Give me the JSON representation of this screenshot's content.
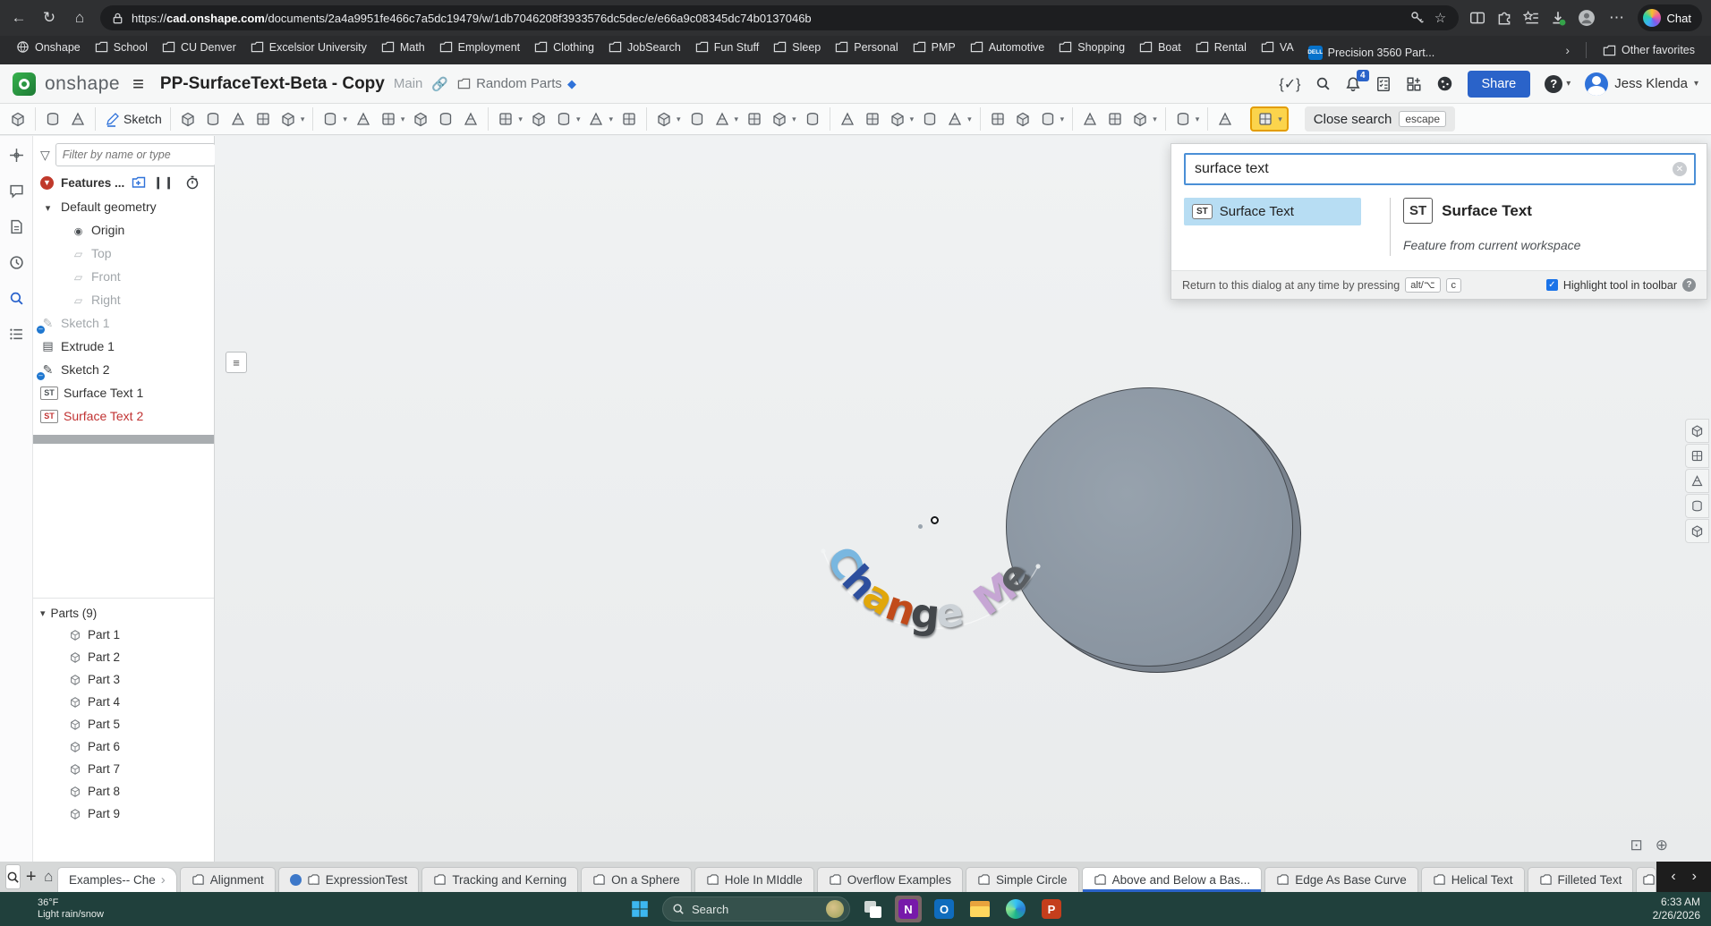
{
  "browser": {
    "url_prefix": "https://",
    "url_host": "cad.onshape.com",
    "url_path": "/documents/2a4a9951fe466c7a5dc19479/w/1db7046208f3933576dc5dec/e/e66a9c08345dc74b0137046b",
    "chat_label": "Chat",
    "bookmarks": [
      {
        "label": "Onshape",
        "icon": "site"
      },
      {
        "label": "School",
        "icon": "folder"
      },
      {
        "label": "CU Denver",
        "icon": "folder"
      },
      {
        "label": "Excelsior University",
        "icon": "folder"
      },
      {
        "label": "Math",
        "icon": "folder"
      },
      {
        "label": "Employment",
        "icon": "folder"
      },
      {
        "label": "Clothing",
        "icon": "folder"
      },
      {
        "label": "JobSearch",
        "icon": "folder"
      },
      {
        "label": "Fun Stuff",
        "icon": "folder"
      },
      {
        "label": "Sleep",
        "icon": "folder"
      },
      {
        "label": "Personal",
        "icon": "folder"
      },
      {
        "label": "PMP",
        "icon": "folder"
      },
      {
        "label": "Automotive",
        "icon": "folder"
      },
      {
        "label": "Shopping",
        "icon": "folder"
      },
      {
        "label": "Boat",
        "icon": "folder"
      },
      {
        "label": "Rental",
        "icon": "folder"
      },
      {
        "label": "VA",
        "icon": "folder"
      },
      {
        "label": "Precision 3560 Part...",
        "icon": "dell"
      }
    ],
    "dell_text": "DELL",
    "overflow_chevron": "›",
    "other_favorites": "Other favorites"
  },
  "header": {
    "brand": "onshape",
    "title": "PP-SurfaceText-Beta - Copy",
    "workspace": "Main",
    "location": "Random Parts",
    "notification_count": "4",
    "fs_icon": "{✓}",
    "share_label": "Share",
    "help_glyph": "?",
    "user_name": "Jess Klenda"
  },
  "toolbar": {
    "items": [
      {
        "n": "feature-list-icon"
      },
      {
        "n": "undo-icon",
        "s": true
      },
      {
        "n": "redo-icon"
      },
      {
        "n": "sketch-button",
        "s": true,
        "label": "Sketch"
      },
      {
        "n": "extrude-icon",
        "s": true
      },
      {
        "n": "revolve-icon"
      },
      {
        "n": "sweep-icon"
      },
      {
        "n": "loft-icon"
      },
      {
        "n": "thicken-icon",
        "c": true
      },
      {
        "n": "fillet-icon",
        "s": true,
        "c": true
      },
      {
        "n": "chamfer-icon"
      },
      {
        "n": "draft-icon",
        "c": true
      },
      {
        "n": "rib-icon"
      },
      {
        "n": "shell-icon"
      },
      {
        "n": "hole-icon"
      },
      {
        "n": "linear-pattern-icon",
        "s": true,
        "c": true
      },
      {
        "n": "circular-pattern-icon"
      },
      {
        "n": "mirror-icon",
        "c": true
      },
      {
        "n": "boolean-icon",
        "c": true
      },
      {
        "n": "split-icon"
      },
      {
        "n": "offset-surface-icon",
        "s": true,
        "c": true
      },
      {
        "n": "fill-surface-icon"
      },
      {
        "n": "ruled-surface-icon",
        "c": true
      },
      {
        "n": "move-face-icon"
      },
      {
        "n": "delete-face-icon",
        "c": true
      },
      {
        "n": "replace-face-icon"
      },
      {
        "n": "helix-icon",
        "s": true
      },
      {
        "n": "fit-spline-icon"
      },
      {
        "n": "projected-curve-icon",
        "c": true
      },
      {
        "n": "bridging-curve-icon"
      },
      {
        "n": "composite-curve-icon",
        "c": true
      },
      {
        "n": "variable-icon",
        "s": true
      },
      {
        "n": "featurescript-icon"
      },
      {
        "n": "derived-icon",
        "c": true
      },
      {
        "n": "measure-icon",
        "s": true
      },
      {
        "n": "mass-properties-icon"
      },
      {
        "n": "section-view-icon",
        "c": true
      },
      {
        "n": "named-views-icon",
        "s": true,
        "c": true
      },
      {
        "n": "select-region-icon",
        "s": true
      },
      {
        "n": "custom-feature-button",
        "hl": true,
        "c": true
      }
    ],
    "close_search_label": "Close search",
    "escape_key": "escape"
  },
  "search_panel": {
    "query": "surface text",
    "result_badge": "ST",
    "result_label": "Surface Text",
    "detail_badge": "ST",
    "detail_title": "Surface Text",
    "detail_subtitle": "Feature from current workspace",
    "footer_text": "Return to this dialog at any time by pressing",
    "key1": "alt/⌥",
    "key2": "c",
    "checkbox_glyph": "✓",
    "checkbox_label": "Highlight tool in toolbar"
  },
  "feature_panel": {
    "filter_placeholder": "Filter by name or type",
    "features_label": "Features ...",
    "pause_glyph": "❙❙",
    "error_glyph": "▼",
    "tree": [
      {
        "label": "Default geometry",
        "icon": "caret"
      },
      {
        "label": "Origin",
        "icon": "origin",
        "indent": 2
      },
      {
        "label": "Top",
        "icon": "plane",
        "indent": 2,
        "muted": true
      },
      {
        "label": "Front",
        "icon": "plane",
        "indent": 2,
        "muted": true
      },
      {
        "label": "Right",
        "icon": "plane",
        "indent": 2,
        "muted": true
      },
      {
        "label": "Sketch 1",
        "icon": "sketch",
        "muted": true
      },
      {
        "label": "Extrude 1",
        "icon": "extrude"
      },
      {
        "label": "Sketch 2",
        "icon": "sketch"
      },
      {
        "label": "Surface Text 1",
        "icon": "st"
      },
      {
        "label": "Surface Text 2",
        "icon": "st",
        "error": true
      }
    ],
    "parts_label": "Parts (9)",
    "parts": [
      "Part 1",
      "Part 2",
      "Part 3",
      "Part 4",
      "Part 5",
      "Part 6",
      "Part 7",
      "Part 8",
      "Part 9"
    ]
  },
  "viewport": {
    "model_text": "Change Me",
    "letters": [
      {
        "ch": "C",
        "color": "#79b7e0"
      },
      {
        "ch": "h",
        "color": "#2d4f9e"
      },
      {
        "ch": "a",
        "color": "#e1a70b"
      },
      {
        "ch": "n",
        "color": "#c14b1b"
      },
      {
        "ch": "g",
        "color": "#43474b"
      },
      {
        "ch": "e",
        "color": "#ccd2d7"
      },
      {
        "ch": " ",
        "color": ""
      },
      {
        "ch": "M",
        "color": "#c6a6d4"
      },
      {
        "ch": "e",
        "color": "#595d61"
      }
    ]
  },
  "tabs": {
    "items": [
      {
        "label": "Examples-- Che",
        "collapsed": true,
        "plain": true
      },
      {
        "label": "Alignment"
      },
      {
        "label": "ExpressionTest",
        "dot": true
      },
      {
        "label": "Tracking and Kerning"
      },
      {
        "label": "On a Sphere"
      },
      {
        "label": "Hole In MIddle"
      },
      {
        "label": "Overflow Examples"
      },
      {
        "label": "Simple Circle"
      },
      {
        "label": "Above and Below a Bas...",
        "active": true
      },
      {
        "label": "Edge As Base Curve"
      },
      {
        "label": "Helical Text"
      },
      {
        "label": "Filleted Text"
      }
    ],
    "nav_left": "‹",
    "nav_right": "›"
  },
  "taskbar": {
    "temp": "36°F",
    "condition": "Light rain/snow",
    "search_label": "Search",
    "onenote_letter": "N",
    "outlook_letter": "O",
    "powerpoint_letter": "P",
    "time": "6:33 AM",
    "date": "2/26/2026"
  }
}
